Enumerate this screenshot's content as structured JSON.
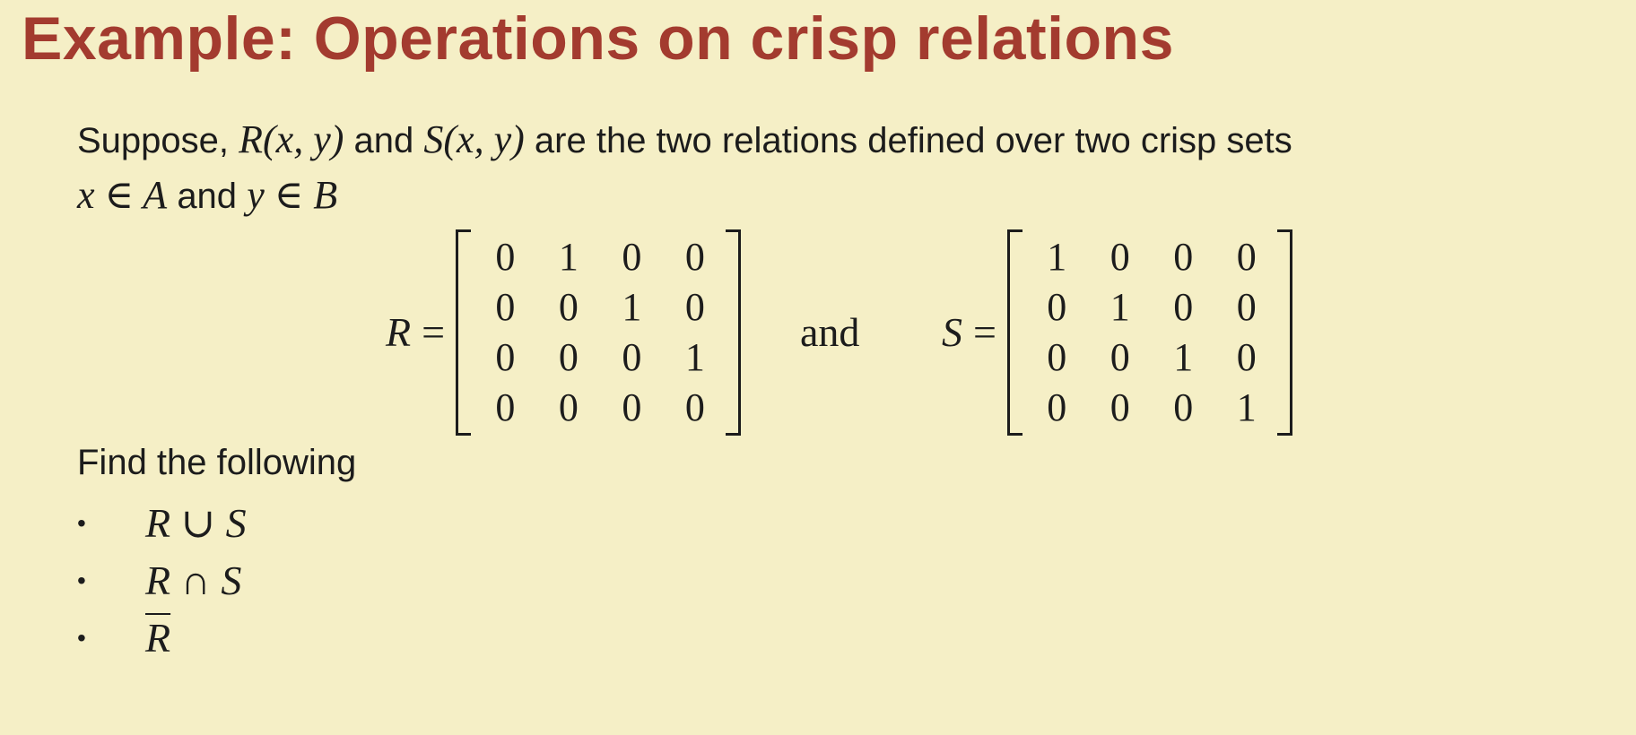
{
  "slide": {
    "title": "Example: Operations on crisp relations",
    "intro": {
      "suppose": "Suppose,",
      "r_xy": "R(x, y)",
      "and1": "and",
      "s_xy": "S(x, y)",
      "rest": "are the two relations defined over two crisp sets",
      "x_in_a": "x ∈ A",
      "and2": "and",
      "y_in_b": "y ∈ B"
    },
    "matrix_r": {
      "name": "R",
      "equals": "=",
      "rows": [
        [
          "0",
          "1",
          "0",
          "0"
        ],
        [
          "0",
          "0",
          "1",
          "0"
        ],
        [
          "0",
          "0",
          "0",
          "1"
        ],
        [
          "0",
          "0",
          "0",
          "0"
        ]
      ]
    },
    "between": "and",
    "matrix_s": {
      "name": "S",
      "equals": "=",
      "rows": [
        [
          "1",
          "0",
          "0",
          "0"
        ],
        [
          "0",
          "1",
          "0",
          "0"
        ],
        [
          "0",
          "0",
          "1",
          "0"
        ],
        [
          "0",
          "0",
          "0",
          "1"
        ]
      ]
    },
    "find_heading": "Find the following",
    "bullet_symbol": "•",
    "tasks": [
      "R ∪ S",
      "R ∩ S",
      "R"
    ]
  }
}
